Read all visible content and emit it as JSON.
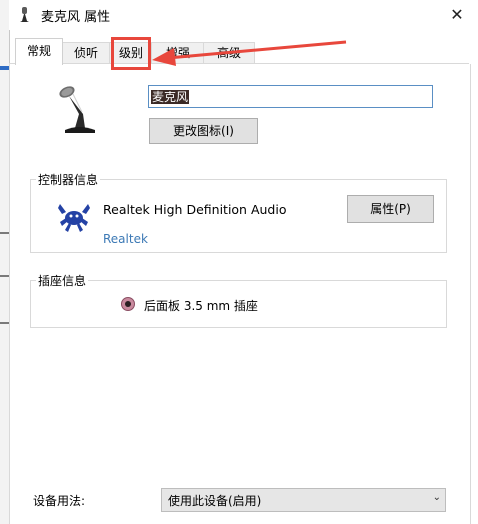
{
  "window": {
    "title": "麦克风 属性",
    "close_glyph": "✕"
  },
  "tabs": [
    {
      "label": "常规",
      "active": true
    },
    {
      "label": "侦听",
      "active": false
    },
    {
      "label": "级别",
      "active": false
    },
    {
      "label": "增强",
      "active": false
    },
    {
      "label": "高级",
      "active": false
    }
  ],
  "general": {
    "device_name_value": "麦克风",
    "change_icon_label": "更改图标(I)"
  },
  "controller": {
    "legend": "控制器信息",
    "device": "Realtek High Definition Audio",
    "vendor": "Realtek",
    "properties_label": "属性(P)"
  },
  "jack": {
    "legend": "插座信息",
    "location": "后面板 3.5 mm 插座"
  },
  "usage": {
    "label": "设备用法:",
    "selected": "使用此设备(启用)"
  },
  "annotation": {
    "highlight_color": "#e8473c"
  }
}
